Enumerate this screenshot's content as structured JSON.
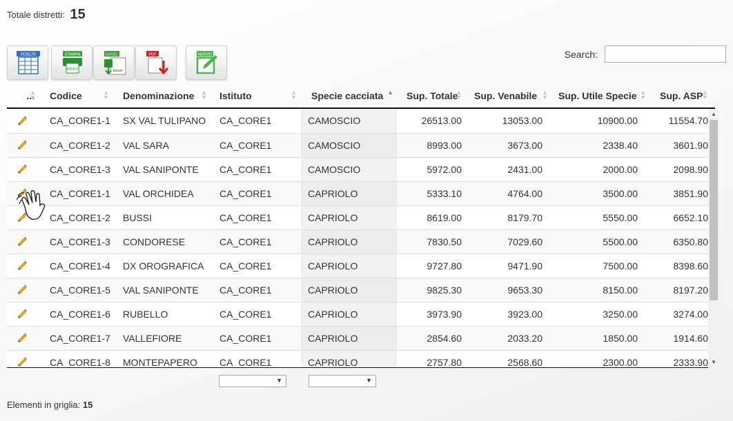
{
  "summary": {
    "label": "Totale distretti:",
    "value": "15"
  },
  "toolbar": {
    "buttons": [
      {
        "name": "scelta-button",
        "label": "SCELTA"
      },
      {
        "name": "stampa-button",
        "label": "STAMPA",
        "sublabel": "PRINT"
      },
      {
        "name": "excel-button",
        "label": "EXCEL",
        "sublabel": "Excel"
      },
      {
        "name": "pdf-button",
        "label": "PDF"
      },
      {
        "name": "nuovo-button",
        "label": "NUOVO"
      }
    ]
  },
  "search": {
    "label": "Search:",
    "value": ""
  },
  "grid": {
    "columns": [
      {
        "key": "action",
        "label": "..."
      },
      {
        "key": "codice",
        "label": "Codice"
      },
      {
        "key": "denominazione",
        "label": "Denominazione"
      },
      {
        "key": "istituto",
        "label": "Istituto"
      },
      {
        "key": "specie",
        "label": "Specie cacciata",
        "sorted": "asc"
      },
      {
        "key": "sup_totale",
        "label": "Sup. Totale"
      },
      {
        "key": "sup_venabile",
        "label": "Sup. Venabile"
      },
      {
        "key": "sup_utile",
        "label": "Sup. Utile Specie"
      },
      {
        "key": "sup_asp",
        "label": "Sup. ASP"
      }
    ],
    "rows": [
      {
        "codice": "CA_CORE1-1",
        "denominazione": "SX VAL TULIPANO",
        "istituto": "CA_CORE1",
        "specie": "CAMOSCIO",
        "sup_totale": "26513.00",
        "sup_venabile": "13053.00",
        "sup_utile": "10900.00",
        "sup_asp": "11554.70"
      },
      {
        "codice": "CA_CORE1-2",
        "denominazione": "VAL SARA",
        "istituto": "CA_CORE1",
        "specie": "CAMOSCIO",
        "sup_totale": "8993.00",
        "sup_venabile": "3673.00",
        "sup_utile": "2338.40",
        "sup_asp": "3601.90"
      },
      {
        "codice": "CA_CORE1-3",
        "denominazione": "VAL SANIPONTE",
        "istituto": "CA_CORE1",
        "specie": "CAMOSCIO",
        "sup_totale": "5972.00",
        "sup_venabile": "2431.00",
        "sup_utile": "2000.00",
        "sup_asp": "2098.90"
      },
      {
        "codice": "CA_CORE1-1",
        "denominazione": "VAL ORCHIDEA",
        "istituto": "CA_CORE1",
        "specie": "CAPRIOLO",
        "sup_totale": "5333.10",
        "sup_venabile": "4764.00",
        "sup_utile": "3500.00",
        "sup_asp": "3851.90"
      },
      {
        "codice": "CA_CORE1-2",
        "denominazione": "BUSSI",
        "istituto": "CA_CORE1",
        "specie": "CAPRIOLO",
        "sup_totale": "8619.00",
        "sup_venabile": "8179.70",
        "sup_utile": "5550.00",
        "sup_asp": "6652.10"
      },
      {
        "codice": "CA_CORE1-3",
        "denominazione": "CONDORESE",
        "istituto": "CA_CORE1",
        "specie": "CAPRIOLO",
        "sup_totale": "7830.50",
        "sup_venabile": "7029.60",
        "sup_utile": "5500.00",
        "sup_asp": "6350.80"
      },
      {
        "codice": "CA_CORE1-4",
        "denominazione": "DX OROGRAFICA",
        "istituto": "CA_CORE1",
        "specie": "CAPRIOLO",
        "sup_totale": "9727.80",
        "sup_venabile": "9471.90",
        "sup_utile": "7500.00",
        "sup_asp": "8398.60"
      },
      {
        "codice": "CA_CORE1-5",
        "denominazione": "VAL SANIPONTE",
        "istituto": "CA_CORE1",
        "specie": "CAPRIOLO",
        "sup_totale": "9825.30",
        "sup_venabile": "9653.30",
        "sup_utile": "8150.00",
        "sup_asp": "8197.20"
      },
      {
        "codice": "CA_CORE1-6",
        "denominazione": "RUBELLO",
        "istituto": "CA_CORE1",
        "specie": "CAPRIOLO",
        "sup_totale": "3973.90",
        "sup_venabile": "3923.00",
        "sup_utile": "3250.00",
        "sup_asp": "3274.00"
      },
      {
        "codice": "CA_CORE1-7",
        "denominazione": "VALLEFIORE",
        "istituto": "CA_CORE1",
        "specie": "CAPRIOLO",
        "sup_totale": "2854.60",
        "sup_venabile": "2033.20",
        "sup_utile": "1850.00",
        "sup_asp": "1914.60"
      },
      {
        "codice": "CA_CORE1-8",
        "denominazione": "MONTEPAPERO",
        "istituto": "CA_CORE1",
        "specie": "CAPRIOLO",
        "sup_totale": "2757.80",
        "sup_venabile": "2568.60",
        "sup_utile": "2300.00",
        "sup_asp": "2333.90"
      }
    ],
    "row_action_icon": "pencil-edit-icon"
  },
  "filters": {
    "istituto_value": "",
    "specie_value": ""
  },
  "footer": {
    "label": "Elementi in griglia:",
    "value": "15"
  },
  "colors": {
    "sort_active": "#6f8fd0",
    "header_border": "#111111",
    "sorted_column_bg": "#f1f1f1"
  }
}
